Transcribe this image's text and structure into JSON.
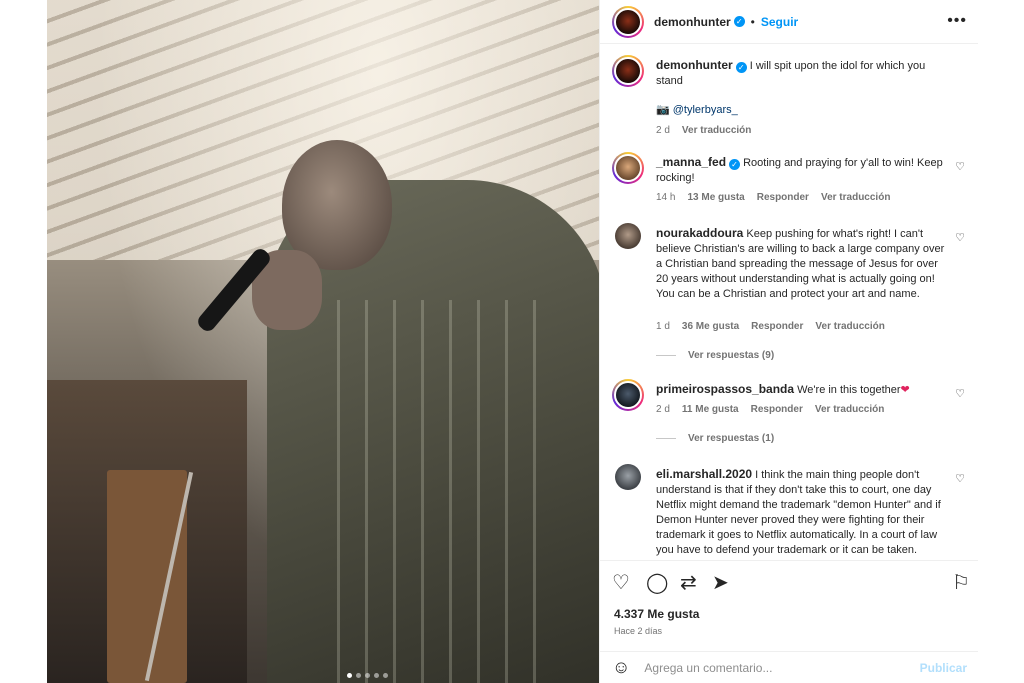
{
  "header": {
    "username": "demonhunter",
    "separator": "•",
    "follow_label": "Seguir",
    "more_label": "•••"
  },
  "caption": {
    "username": "demonhunter",
    "text": "I will spit upon the idol for which you stand",
    "tag_icon": "camera-emoji",
    "mention": "@tylerbyars_",
    "time": "2 d",
    "translate": "Ver traducción"
  },
  "comments": [
    {
      "username": "_manna_fed",
      "verified": true,
      "text": "Rooting and praying for y'all to win! Keep rocking!",
      "time": "14 h",
      "likes": "13 Me gusta",
      "reply": "Responder",
      "translate": "Ver traducción"
    },
    {
      "username": "nourakaddoura",
      "text": "Keep pushing for what's right! I can't believe Christian's are willing to back a large company over a Christian band spreading the message of Jesus for over 20 years without understanding what is actually going on! You can be a Christian and protect your art and name.",
      "time": "1 d",
      "likes": "36 Me gusta",
      "reply": "Responder",
      "translate": "Ver traducción",
      "replies": "Ver respuestas (9)"
    },
    {
      "username": "primeirospassos_banda",
      "text": "We're in this together",
      "emoji": "❤",
      "time": "2 d",
      "likes": "11 Me gusta",
      "reply": "Responder",
      "translate": "Ver traducción",
      "replies": "Ver respuestas (1)"
    },
    {
      "username": "eli.marshall.2020",
      "text": "I think the main thing people don't understand is that if they don't take this to court, one day Netflix might demand the trademark \"demon Hunter\" and if Demon Hunter never proved they were fighting for their trademark it goes to Netflix automatically. In a court of law you have to defend your trademark or it can be taken."
    }
  ],
  "footer": {
    "likes": "4.337 Me gusta",
    "time": "Hace 2 días",
    "comment_placeholder": "Agrega un comentario...",
    "publish_label": "Publicar"
  },
  "carousel": {
    "total": 5,
    "active": 0
  },
  "colors": {
    "accent": "#0095f6",
    "text": "#262626",
    "muted": "#737373",
    "heart": "#e0245e"
  }
}
